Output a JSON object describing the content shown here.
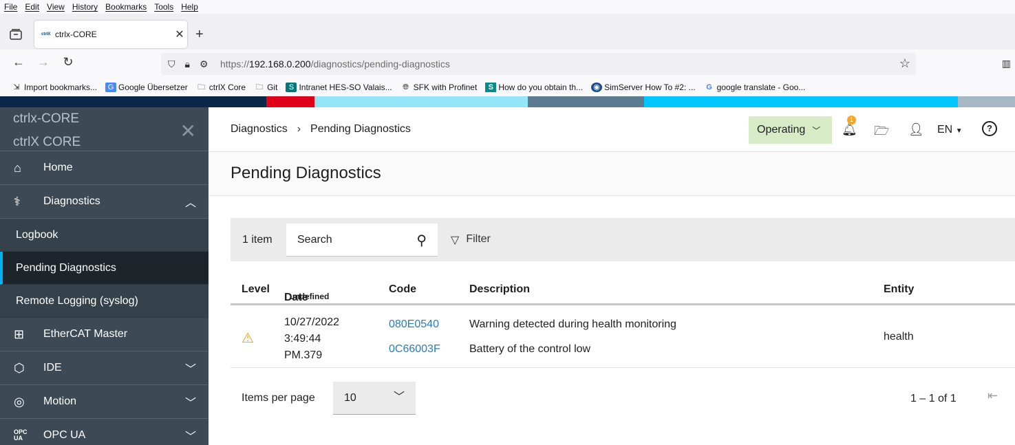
{
  "browser": {
    "menu": [
      "File",
      "Edit",
      "View",
      "History",
      "Bookmarks",
      "Tools",
      "Help"
    ],
    "tab": {
      "favicon_text": "ctrlX",
      "title": "ctrlx-CORE"
    },
    "url_prefix": "https://",
    "url_host": "192.168.0.200",
    "url_path": "/diagnostics/pending-diagnostics",
    "bookmarks": [
      {
        "icon": "import-icon",
        "label": "Import bookmarks..."
      },
      {
        "icon": "google-translate-icon",
        "label": "Google Übersetzer"
      },
      {
        "icon": "folder-icon",
        "label": "ctrlX Core"
      },
      {
        "icon": "folder-icon",
        "label": "Git"
      },
      {
        "icon": "sharepoint-icon",
        "label": "Intranet HES-SO Valais..."
      },
      {
        "icon": "globe-icon",
        "label": "SFK with Profinet"
      },
      {
        "icon": "s-icon",
        "label": "How do you obtain th..."
      },
      {
        "icon": "siemens-icon",
        "label": "SimServer How To #2: ..."
      },
      {
        "icon": "google-icon",
        "label": "google translate - Goo..."
      }
    ]
  },
  "stripe_colors": [
    "#0b2747",
    "#e1001a",
    "#93e5f8",
    "#5c7b90",
    "#00c6ff",
    "#a7b7c4"
  ],
  "sidebar": {
    "title_line1": "ctrlx-CORE",
    "title_line2": "ctrlX CORE",
    "items": [
      {
        "label": "Home",
        "icon": "home-icon"
      },
      {
        "label": "Diagnostics",
        "icon": "stethoscope-icon",
        "expanded": true
      },
      {
        "label": "Logbook",
        "sub": true
      },
      {
        "label": "Pending Diagnostics",
        "sub": true,
        "active": true
      },
      {
        "label": "Remote Logging (syslog)",
        "sub": true
      },
      {
        "label": "EtherCAT Master",
        "icon": "network-icon"
      },
      {
        "label": "IDE",
        "icon": "package-icon",
        "expandable": true
      },
      {
        "label": "Motion",
        "icon": "motion-icon",
        "expandable": true
      },
      {
        "label": "OPC UA",
        "icon": "opcua-icon",
        "expandable": true
      }
    ]
  },
  "header": {
    "breadcrumb": [
      "Diagnostics",
      "Pending Diagnostics"
    ],
    "state": "Operating",
    "notification_count": "1",
    "language": "EN"
  },
  "page": {
    "title": "Pending Diagnostics"
  },
  "toolbar": {
    "count": "1 item",
    "search_placeholder": "Search",
    "filter_label": "Filter"
  },
  "table": {
    "headers": {
      "level": "Level",
      "date": "Date",
      "date_sub": "undefined",
      "code": "Code",
      "description": "Description",
      "entity": "Entity"
    },
    "rows": [
      {
        "level": "warning-icon",
        "date_line1": "10/27/2022",
        "date_line2": "3:49:44",
        "date_line3": "PM.379",
        "code1": "080E0540",
        "code2": "0C66003F",
        "desc1": "Warning detected during health monitoring",
        "desc2": "Battery of the control low",
        "entity": "health"
      }
    ]
  },
  "pager": {
    "items_per_page_label": "Items per page",
    "items_per_page": "10",
    "range": "1 – 1 of 1"
  }
}
